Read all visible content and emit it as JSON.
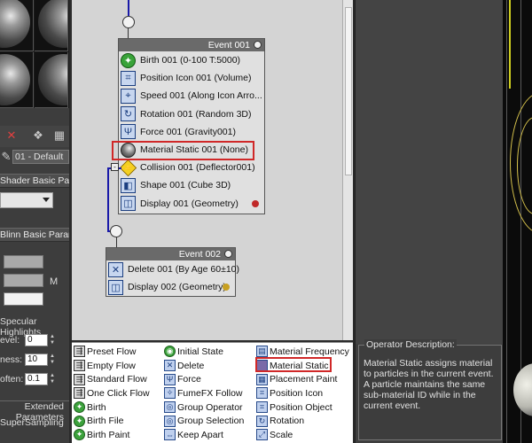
{
  "material_editor": {
    "toolbar_icons": [
      "close-x-icon",
      "assign-material-icon",
      "material-effects-icon"
    ],
    "material_name": "01 - Default",
    "rollouts": {
      "shader_basic": "Shader Basic Parameters",
      "blinn_basic": "Blinn Basic Parameters",
      "extended": "Extended Parameters",
      "super": "SuperSampling"
    },
    "swatch_colors": [
      "#a9a9a9",
      "#a9a9a9",
      "#f2f2f2"
    ],
    "map_letter": "M",
    "specular_section": "Specular Highlights",
    "params": [
      {
        "label": "evel:",
        "value": "0"
      },
      {
        "label": "ness:",
        "value": "10"
      },
      {
        "label": "often:",
        "value": "0.1"
      }
    ]
  },
  "particle_view": {
    "events": [
      {
        "title": "Event 001",
        "operators": [
          {
            "label": "Birth 001 (0-100 T:5000)",
            "icon": "birth-icon"
          },
          {
            "label": "Position Icon 001 (Volume)",
            "icon": "position-icon"
          },
          {
            "label": "Speed 001 (Along Icon Arro...",
            "icon": "speed-icon"
          },
          {
            "label": "Rotation 001 (Random 3D)",
            "icon": "rotation-icon"
          },
          {
            "label": "Force 001 (Gravity001)",
            "icon": "force-icon"
          },
          {
            "label": "Material Static 001 (None)",
            "icon": "material-static-icon"
          },
          {
            "label": "Collision 001 (Deflector001)",
            "icon": "collision-icon"
          },
          {
            "label": "Shape 001 (Cube 3D)",
            "icon": "shape-icon"
          },
          {
            "label": "Display 001 (Geometry)",
            "icon": "display-icon",
            "dot_color": "#c02828"
          }
        ]
      },
      {
        "title": "Event 002",
        "operators": [
          {
            "label": "Delete 001 (By Age 60±10)",
            "icon": "delete-icon"
          },
          {
            "label": "Display 002 (Geometry)",
            "icon": "display-icon",
            "dot_color": "#c8a020"
          }
        ]
      }
    ],
    "highlight_color": "#d02828",
    "wire_color": "#1a1aa8"
  },
  "depot": {
    "col1": [
      {
        "label": "Preset Flow",
        "icon": "flow-icon"
      },
      {
        "label": "Empty Flow",
        "icon": "flow-icon"
      },
      {
        "label": "Standard Flow",
        "icon": "flow-icon"
      },
      {
        "label": "One Click Flow",
        "icon": "flow-icon"
      },
      {
        "label": "Birth",
        "icon": "birth-icon"
      },
      {
        "label": "Birth File",
        "icon": "birth-icon"
      },
      {
        "label": "Birth Paint",
        "icon": "birth-icon"
      }
    ],
    "col2": [
      {
        "label": "Initial State",
        "icon": "initial-state-icon"
      },
      {
        "label": "Delete",
        "icon": "delete-icon"
      },
      {
        "label": "Force",
        "icon": "force-icon"
      },
      {
        "label": "FumeFX Follow",
        "icon": "fumefx-icon"
      },
      {
        "label": "Group Operator",
        "icon": "group-operator-icon"
      },
      {
        "label": "Group Selection",
        "icon": "group-selection-icon"
      },
      {
        "label": "Keep Apart",
        "icon": "keep-apart-icon"
      }
    ],
    "col3": [
      {
        "label": "Material Frequency",
        "icon": "material-icon"
      },
      {
        "label": "Material Static",
        "icon": "material-icon"
      },
      {
        "label": "Placement Paint",
        "icon": "placement-icon"
      },
      {
        "label": "Position Icon",
        "icon": "position-icon"
      },
      {
        "label": "Position Object",
        "icon": "position-icon"
      },
      {
        "label": "Rotation",
        "icon": "rotation-icon"
      },
      {
        "label": "Scale",
        "icon": "scale-icon"
      }
    ]
  },
  "description": {
    "title": "Operator Description:",
    "text": "Material Static assigns material to particles in the current event.  A particle maintains the same sub-material ID while in the current event."
  }
}
